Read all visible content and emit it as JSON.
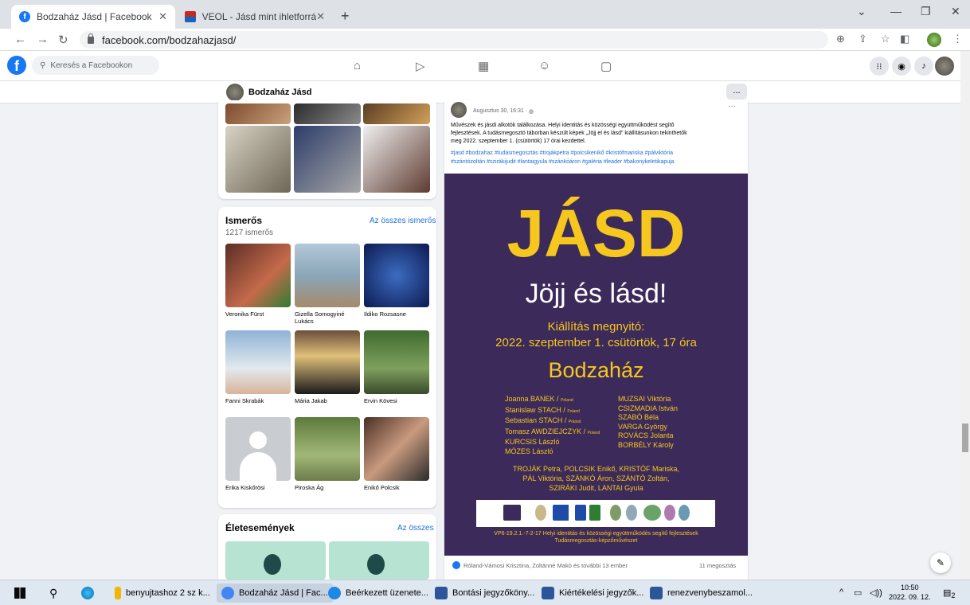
{
  "browser": {
    "tabs": [
      {
        "title": "Bodzaház Jásd | Facebook",
        "active": true
      },
      {
        "title": "VEOL - Jásd mint ihletforrás: egy",
        "active": false
      }
    ],
    "url": "facebook.com/bodzahazjasd/"
  },
  "fb_header": {
    "search_placeholder": "Keresés a Facebookon"
  },
  "page": {
    "name": "Bodzaház Jásd",
    "more": "..."
  },
  "friends": {
    "heading": "Ismerős",
    "count": "1217 ismerős",
    "see_all": "Az összes ismerős",
    "items": [
      {
        "name": "Veronika Fürst"
      },
      {
        "name": "Gizella Somogyiné Lukács"
      },
      {
        "name": "Ildiko Rozsasne"
      },
      {
        "name": "Fanni Skrabák"
      },
      {
        "name": "Mária Jakab"
      },
      {
        "name": "Ervin Kövesi"
      },
      {
        "name": "Erika Kiskőrösi"
      },
      {
        "name": "Piroska Ág"
      },
      {
        "name": "Enikő Polcsik"
      }
    ]
  },
  "life_events": {
    "heading": "Életesemények",
    "see_all": "Az összes"
  },
  "post": {
    "meta": "Augusztus 30, 16:31 ·",
    "text_lines": [
      "Művészek és jásdi alkotók találkozása. Helyi identitás és közösségi együttműködést segítő",
      "fejlesztések. A tudásmegosztó táborban készült képek „Jöjj el és lásd\" kiállításunkon tekinthetők",
      "meg 2022. szeptember 1. (csütörtök) 17 órai kezdettel."
    ],
    "hashtag_lines": [
      "#jasd #bodzahaz #tudásmegosztás #trojákpetra #polcsikenikő #kristófmariska #pálviktória",
      "#szántózoltán #szirákijudit #lantaigyula #szánkóáron #galéria #leader #bakonykeletikapuja"
    ],
    "more": "···",
    "reactions": "Róland-Vámosi Krisztina, Zoltánné Makó és további 13 ember",
    "shares": "11 megosztás"
  },
  "poster": {
    "title": "JÁSD",
    "subtitle": "Jöjj és lásd!",
    "event": "Kiállítás megnyitó:",
    "date": "2022. szeptember 1. csütörtök, 17 óra",
    "venue": "Bodzaház",
    "artists_left": [
      {
        "name": "Joanna BANEK /",
        "note": "Poland"
      },
      {
        "name": "Stanislaw STACH /",
        "note": "Poland"
      },
      {
        "name": "Sebastian STACH /",
        "note": "Poland"
      },
      {
        "name": "Tomasz AWDZIEJCZYK /",
        "note": "Poland"
      },
      {
        "name": "KURCSIS László",
        "note": ""
      },
      {
        "name": "MÓZES László",
        "note": ""
      }
    ],
    "artists_right": [
      "MUZSAI Viktória",
      "CSIZMADIA István",
      "SZABÓ Béla",
      "VARGA György",
      "ROVÁCS Jolanta",
      "BORBÉLY Károly"
    ],
    "contributors": [
      "TROJÁK Petra, POLCSIK Enikő, KRISTÓF Mariska,",
      "PÁL Viktória, SZÁNKÓ Áron, SZÁNTÓ Zoltán,",
      "SZIRÁKI Judit, LANTAI Gyula"
    ],
    "footer_lines": [
      "VP6-19.2.1.-7-2-17 Helyi identitás és közösségi együttműködés segítő fejlesztések",
      "Tudásmegosztás-képzőművészet"
    ]
  },
  "taskbar": {
    "items": [
      {
        "label": "benyujtashoz 2 sz k...",
        "color": "#f4b400"
      },
      {
        "label": "Bodzaház Jásd | Fac...",
        "color": "#4285f4"
      },
      {
        "label": "Beérkezett üzenete...",
        "color": "#1e88e5"
      },
      {
        "label": "Bontási jegyzőköny...",
        "color": "#2b579a"
      },
      {
        "label": "Kiértékelési jegyzők...",
        "color": "#2b579a"
      },
      {
        "label": "renezvenybeszamol...",
        "color": "#2b579a"
      }
    ],
    "time": "10:50",
    "date": "2022. 09. 12.",
    "notif": "2"
  },
  "colors": {
    "fb_blue": "#1877f2",
    "poster_bg": "#3b2a5a",
    "poster_yellow": "#f6c71e"
  }
}
